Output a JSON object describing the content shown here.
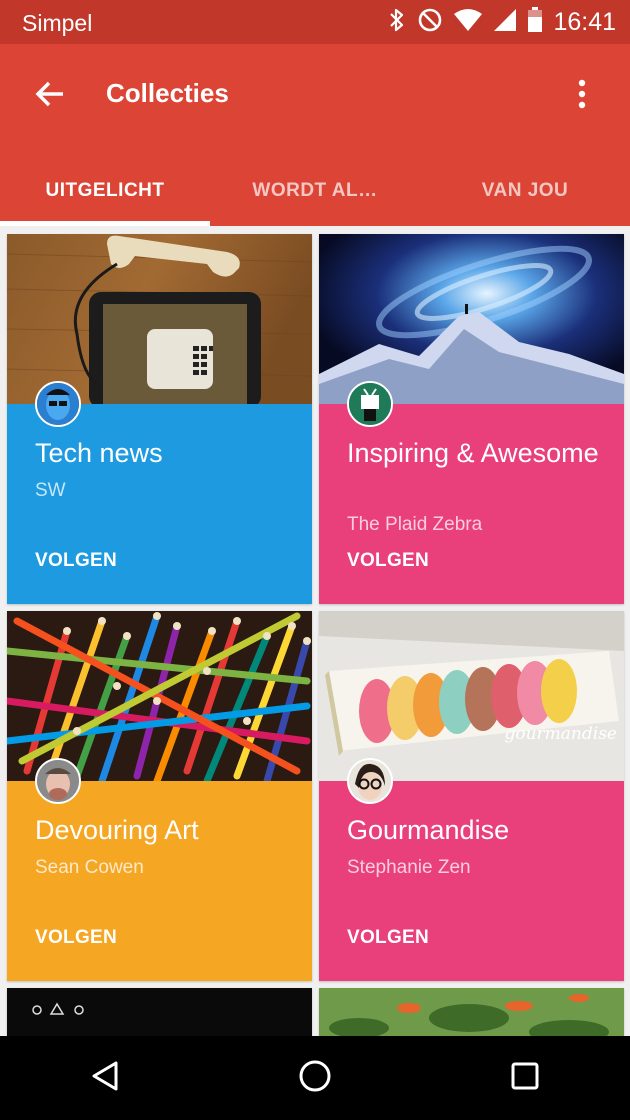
{
  "status_bar": {
    "carrier": "Simpel",
    "time": "16:41",
    "icons": [
      "bluetooth-icon",
      "do-not-disturb-icon",
      "wifi-icon",
      "signal-icon",
      "battery-icon"
    ]
  },
  "app_bar": {
    "title": "Collecties",
    "back_icon": "arrow-back-icon",
    "menu_icon": "more-vert-icon",
    "color": "#dc4536"
  },
  "tabs": [
    {
      "label": "UITGELICHT",
      "active": true
    },
    {
      "label": "WORDT AL…",
      "active": false
    },
    {
      "label": "VAN JOU",
      "active": false
    }
  ],
  "collections": [
    {
      "title": "Tech news",
      "author": "SW",
      "action": "VOLGEN",
      "color": "#1e9ae0",
      "image": "telephone-and-tablet"
    },
    {
      "title": "Inspiring & Awesome",
      "author": "The Plaid Zebra",
      "action": "VOLGEN",
      "color": "#e93f7b",
      "image": "galaxy-mountain"
    },
    {
      "title": "Devouring Art",
      "author": "Sean Cowen",
      "action": "VOLGEN",
      "color": "#f5a623",
      "image": "colored-pencils"
    },
    {
      "title": "Gourmandise",
      "author": "Stephanie Zen",
      "action": "VOLGEN",
      "color": "#e93f7b",
      "image": "macarons",
      "image_caption": "gourmandise"
    }
  ],
  "nav_bar": {
    "icons": [
      "back-triangle-icon",
      "home-circle-icon",
      "recents-square-icon"
    ]
  }
}
